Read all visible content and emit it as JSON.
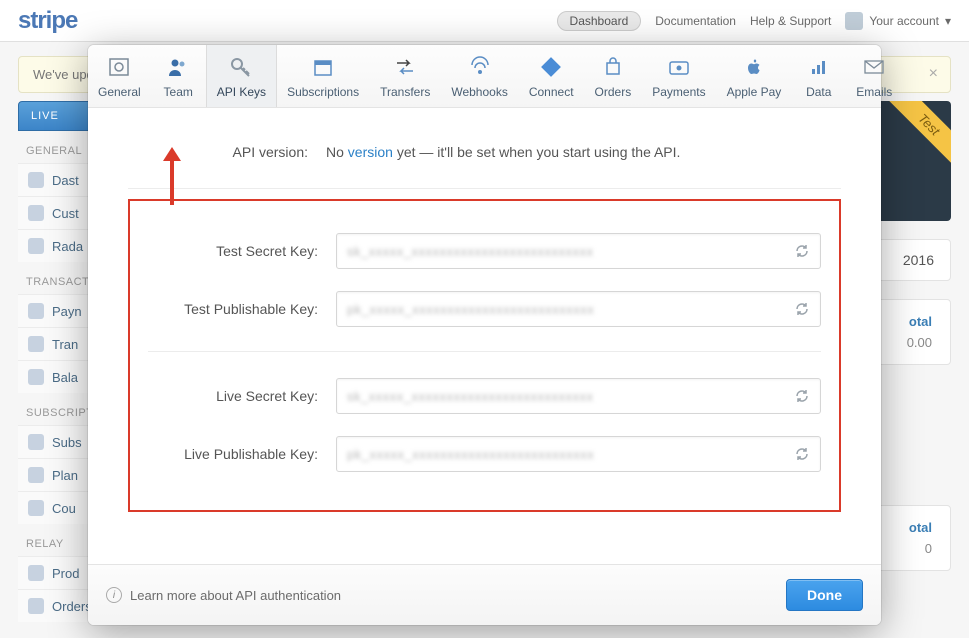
{
  "brand": "stripe",
  "topnav": {
    "dashboard": "Dashboard",
    "documentation": "Documentation",
    "help": "Help & Support",
    "account": "Your account"
  },
  "notice": {
    "text": "We've upd"
  },
  "sidebar": {
    "live": "LIVE",
    "groups": [
      {
        "title": "GENERAL",
        "items": [
          "Dast",
          "Cust",
          "Rada"
        ]
      },
      {
        "title": "TRANSACT",
        "items": [
          "Payn",
          "Tran",
          "Bala"
        ]
      },
      {
        "title": "SUBSCRIPT",
        "items": [
          "Subs",
          "Plan",
          "Cou"
        ]
      },
      {
        "title": "RELAY",
        "items": [
          "Prod",
          "Orders"
        ]
      }
    ]
  },
  "hero": {
    "ribbon": "Test"
  },
  "panel_year": "2016",
  "right_panel": {
    "header": "otal",
    "value": "0.00"
  },
  "modal": {
    "tabs": [
      "General",
      "Team",
      "API Keys",
      "Subscriptions",
      "Transfers",
      "Webhooks",
      "Connect",
      "Orders",
      "Payments",
      "Apple Pay",
      "Data",
      "Emails"
    ],
    "active_tab_index": 2,
    "api_version_label": "API version:",
    "api_version_text_prefix": "No ",
    "api_version_link": "version",
    "api_version_text_suffix": " yet — it'll be set when you start using the API.",
    "keys": {
      "test_secret_label": "Test Secret Key:",
      "test_secret_value": "sk_xxxxx_xxxxxxxxxxxxxxxxxxxxxxxxxx",
      "test_pub_label": "Test Publishable Key:",
      "test_pub_value": "pk_xxxxx_xxxxxxxxxxxxxxxxxxxxxxxxxx",
      "live_secret_label": "Live Secret Key:",
      "live_secret_value": "sk_xxxxx_xxxxxxxxxxxxxxxxxxxxxxxxxx",
      "live_pub_label": "Live Publishable Key:",
      "live_pub_value": "pk_xxxxx_xxxxxxxxxxxxxxxxxxxxxxxxxx"
    },
    "footer_learn": "Learn more about API authentication",
    "done": "Done"
  }
}
